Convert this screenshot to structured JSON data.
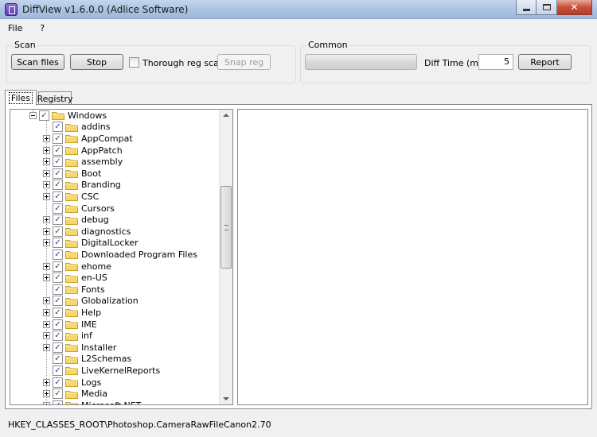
{
  "window": {
    "title": "DiffView v1.6.0.0 (Adlice Software)",
    "app_icon": "diffview-icon",
    "controls": {
      "minimize": "minimize-icon",
      "maximize": "maximize-icon",
      "close": "close-icon"
    }
  },
  "menu": [
    {
      "label": "File"
    },
    {
      "label": "?"
    }
  ],
  "scan": {
    "group_title": "Scan",
    "scan_files_label": "Scan files",
    "stop_label": "Stop",
    "thorough_label": "Thorough reg scan",
    "thorough_checked": false,
    "snap_reg_label": "Snap reg"
  },
  "common": {
    "group_title": "Common",
    "progress": 0,
    "diff_time_label": "Diff Time (mn)",
    "diff_time_value": "5",
    "report_label": "Report"
  },
  "tabs": [
    {
      "label": "Files",
      "active": true
    },
    {
      "label": "Registry",
      "active": false
    }
  ],
  "tree": {
    "root": {
      "label": "Windows",
      "checked": true,
      "expanded": true
    },
    "children": [
      {
        "label": "addins",
        "expandable": false
      },
      {
        "label": "AppCompat",
        "expandable": true
      },
      {
        "label": "AppPatch",
        "expandable": true
      },
      {
        "label": "assembly",
        "expandable": true
      },
      {
        "label": "Boot",
        "expandable": true
      },
      {
        "label": "Branding",
        "expandable": true
      },
      {
        "label": "CSC",
        "expandable": true
      },
      {
        "label": "Cursors",
        "expandable": false
      },
      {
        "label": "debug",
        "expandable": true
      },
      {
        "label": "diagnostics",
        "expandable": true
      },
      {
        "label": "DigitalLocker",
        "expandable": true
      },
      {
        "label": "Downloaded Program Files",
        "expandable": false
      },
      {
        "label": "ehome",
        "expandable": true
      },
      {
        "label": "en-US",
        "expandable": true
      },
      {
        "label": "Fonts",
        "expandable": false
      },
      {
        "label": "Globalization",
        "expandable": true
      },
      {
        "label": "Help",
        "expandable": true
      },
      {
        "label": "IME",
        "expandable": true
      },
      {
        "label": "inf",
        "expandable": true
      },
      {
        "label": "Installer",
        "expandable": true
      },
      {
        "label": "L2Schemas",
        "expandable": false
      },
      {
        "label": "LiveKernelReports",
        "expandable": false
      },
      {
        "label": "Logs",
        "expandable": true
      },
      {
        "label": "Media",
        "expandable": true
      },
      {
        "label": "Microsoft.NET",
        "expandable": true
      }
    ]
  },
  "status": {
    "text": "HKEY_CLASSES_ROOT\\Photoshop.CameraRawFileCanon2.70"
  },
  "colors": {
    "folder": "#f5d76e",
    "folder_edge": "#c9a227",
    "check": "#2a4a8a"
  }
}
